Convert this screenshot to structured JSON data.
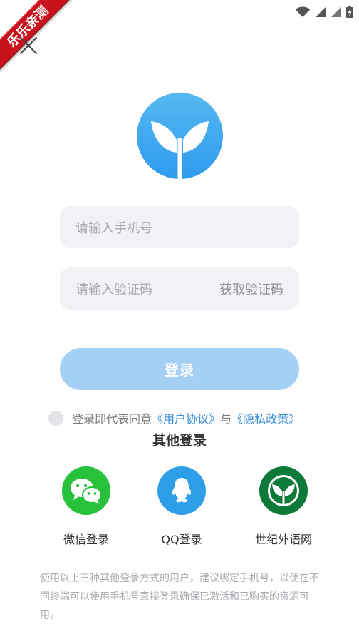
{
  "watermark": {
    "text": "乐乐亲测"
  },
  "icons": {
    "status": [
      "wifi-icon",
      "signal-icon",
      "signal-icon",
      "battery-charging-icon"
    ],
    "close": "close-icon",
    "logo": "sprout-logo-icon"
  },
  "colors": {
    "brand_blue": "#3fa9f5",
    "login_button": "#a4d0f6",
    "link": "#3a8fd8",
    "wechat": "#27c13b",
    "qq": "#2f9ee8",
    "shiji": "#0e7a3a"
  },
  "form": {
    "phone_placeholder": "请输入手机号",
    "code_placeholder": "请输入验证码",
    "get_code": "获取验证码",
    "login": "登录"
  },
  "agreement": {
    "prefix": "登录即代表同意",
    "user_agreement": "《用户协议》",
    "conjunction": "与",
    "privacy_policy": "《隐私政策》",
    "checked": false
  },
  "other_login": {
    "title": "其他登录",
    "methods": [
      {
        "label": "微信登录",
        "icon": "wechat-icon"
      },
      {
        "label": "QQ登录",
        "icon": "qq-icon"
      },
      {
        "label": "世纪外语网",
        "icon": "shiji-sprout-icon"
      }
    ]
  },
  "note": "使用以上三种其他登录方式的用户，建议绑定手机号，以便在不同终端可以使用手机号直接登录确保已激活和已购买的资源可用。"
}
